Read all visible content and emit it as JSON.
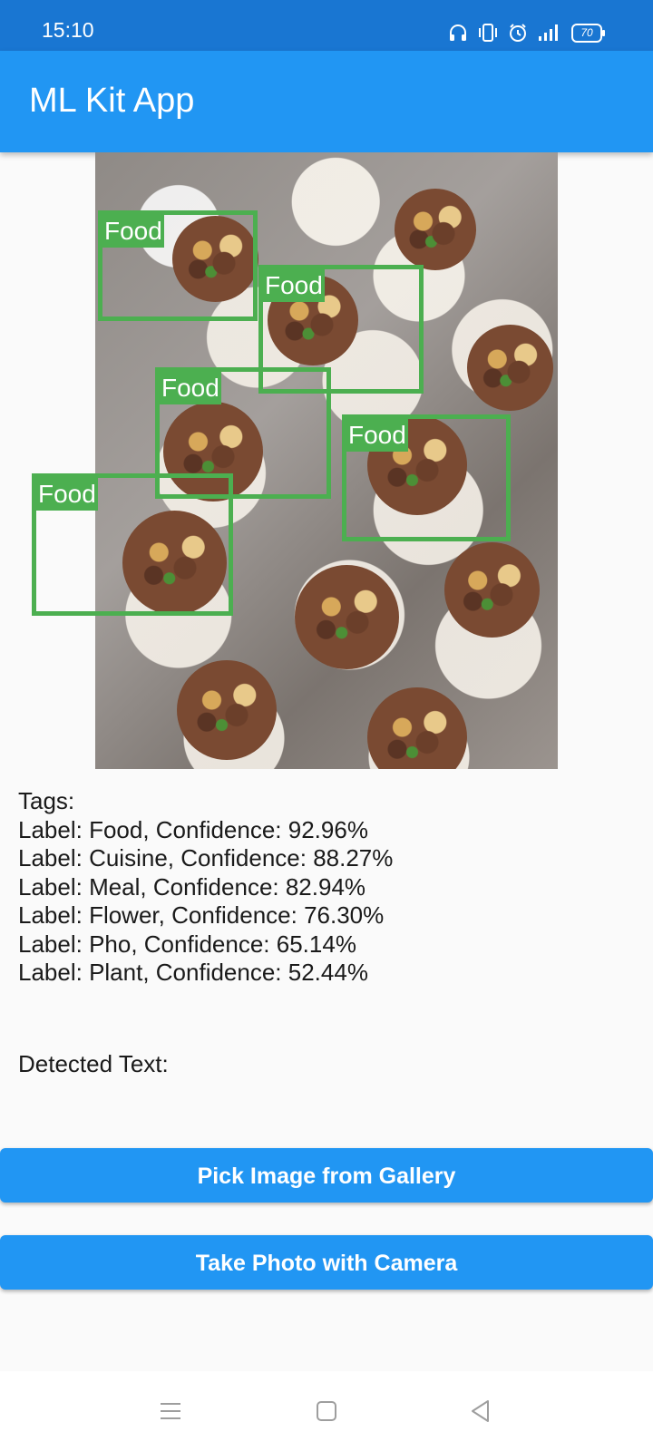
{
  "status_bar": {
    "time": "15:10",
    "battery": "70",
    "icons": [
      "headphones-icon",
      "vibrate-icon",
      "alarm-icon",
      "signal-icon",
      "battery-icon"
    ]
  },
  "app_bar": {
    "title": "ML Kit App"
  },
  "image": {
    "description_icon": "food-photo",
    "detections": [
      {
        "label": "Food"
      },
      {
        "label": "Food"
      },
      {
        "label": "Food"
      },
      {
        "label": "Food"
      },
      {
        "label": "Food"
      }
    ]
  },
  "results": {
    "tags_heading": "Tags:",
    "tags": [
      "Label: Food, Confidence: 92.96%",
      "Label: Cuisine, Confidence: 88.27%",
      "Label: Meal, Confidence: 82.94%",
      "Label: Flower, Confidence: 76.30%",
      "Label: Pho, Confidence: 65.14%",
      "Label: Plant, Confidence: 52.44%"
    ],
    "detected_text_heading": "Detected Text:"
  },
  "actions": {
    "gallery_button": "Pick Image from Gallery",
    "camera_button": "Take Photo with Camera"
  },
  "colors": {
    "status_bar": "#1976d2",
    "app_bar": "#2196f3",
    "button": "#2196f3",
    "detection_box": "#4caf50"
  },
  "nav_bar": {
    "icons": [
      "menu-icon",
      "home-icon",
      "back-icon"
    ]
  }
}
